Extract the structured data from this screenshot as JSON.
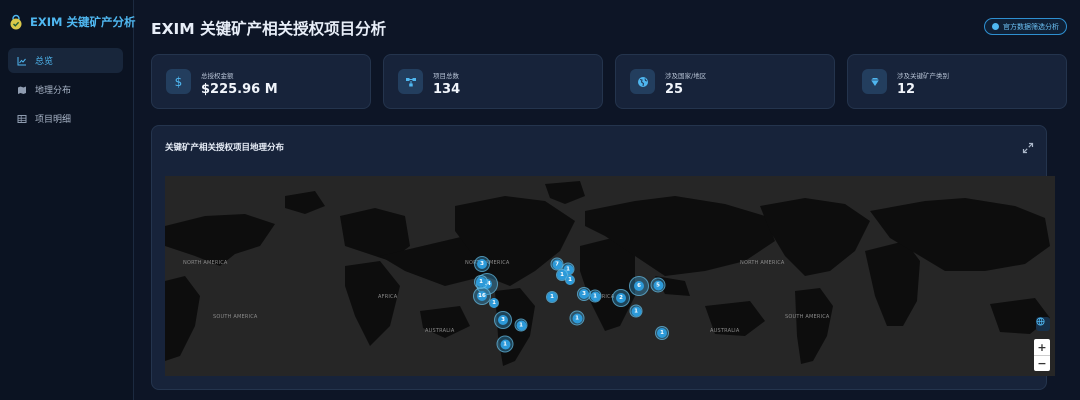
{
  "brand": {
    "title": "EXIM 关键矿产分析",
    "logo_icon": "shield-check-icon"
  },
  "nav": {
    "items": [
      {
        "label": "总览",
        "icon": "line-chart-icon",
        "active": true
      },
      {
        "label": "地理分布",
        "icon": "map-icon",
        "active": false
      },
      {
        "label": "项目明细",
        "icon": "table-icon",
        "active": false
      }
    ]
  },
  "header": {
    "title": "EXIM 关键矿产相关授权项目分析",
    "official_button": "官方数据筛选分析"
  },
  "stats": [
    {
      "label": "总授权金额",
      "value": "$225.96 M",
      "icon": "dollar-icon"
    },
    {
      "label": "项目总数",
      "value": "134",
      "icon": "network-icon"
    },
    {
      "label": "涉及国家/地区",
      "value": "25",
      "icon": "globe-icon"
    },
    {
      "label": "涉及关键矿产类别",
      "value": "12",
      "icon": "gem-icon"
    }
  ],
  "map": {
    "title": "关键矿产相关授权项目地理分布",
    "zoom_in": "+",
    "zoom_out": "−",
    "clusters": [
      "3",
      "14",
      "16",
      "1",
      "1",
      "7",
      "1",
      "1",
      "1",
      "1",
      "3",
      "1",
      "2",
      "1",
      "6",
      "5",
      "1",
      "3",
      "1",
      "1",
      "1"
    ],
    "labels": [
      "NORTH AMERICA",
      "SOUTH AMERICA",
      "AFRICA",
      "AUSTRALIA",
      "NORTH AMERICA",
      "AFRICA",
      "AUSTRALIA",
      "NORTH AMERICA",
      "SOUTH AMERICA"
    ]
  },
  "colors": {
    "accent": "#4fb7f0",
    "background": "#0d1526",
    "card": "#17233a"
  }
}
